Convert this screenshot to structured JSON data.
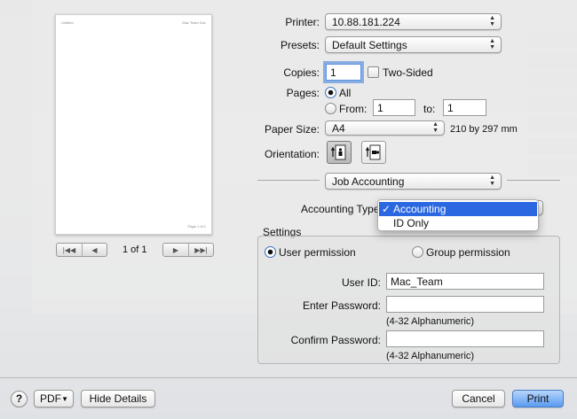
{
  "preview": {
    "header_left": "Untitled",
    "header_right": "Mac Team Doc",
    "footer": "Page 1 of 1",
    "page_indicator": "1 of 1"
  },
  "printer": {
    "label": "Printer:",
    "value": "10.88.181.224"
  },
  "presets": {
    "label": "Presets:",
    "value": "Default Settings"
  },
  "copies": {
    "label": "Copies:",
    "value": "1",
    "two_sided_label": "Two-Sided"
  },
  "pages": {
    "label": "Pages:",
    "all_label": "All",
    "from_label": "From:",
    "from_value": "1",
    "to_label": "to:",
    "to_value": "1"
  },
  "paper_size": {
    "label": "Paper Size:",
    "value": "A4",
    "dimensions": "210 by 297 mm"
  },
  "orientation": {
    "label": "Orientation:"
  },
  "section_popup": {
    "value": "Job Accounting"
  },
  "accounting_type": {
    "label": "Accounting Type",
    "menu_options": [
      "Accounting",
      "ID Only"
    ],
    "selected": "Accounting",
    "check_mark": "✓"
  },
  "settings": {
    "title": "Settings",
    "user_permission_label": "User permission",
    "group_permission_label": "Group permission",
    "user_id_label": "User ID:",
    "user_id_value": "Mac_Team",
    "enter_password_label": "Enter Password:",
    "enter_password_hint": "(4-32 Alphanumeric)",
    "confirm_password_label": "Confirm Password:",
    "confirm_password_hint": "(4-32 Alphanumeric)"
  },
  "footer": {
    "help_label": "?",
    "pdf_label": "PDF",
    "hide_details_label": "Hide Details",
    "cancel_label": "Cancel",
    "print_label": "Print"
  },
  "colors": {
    "accent": "#2a67e0",
    "default_button": "#5a9bf1"
  }
}
